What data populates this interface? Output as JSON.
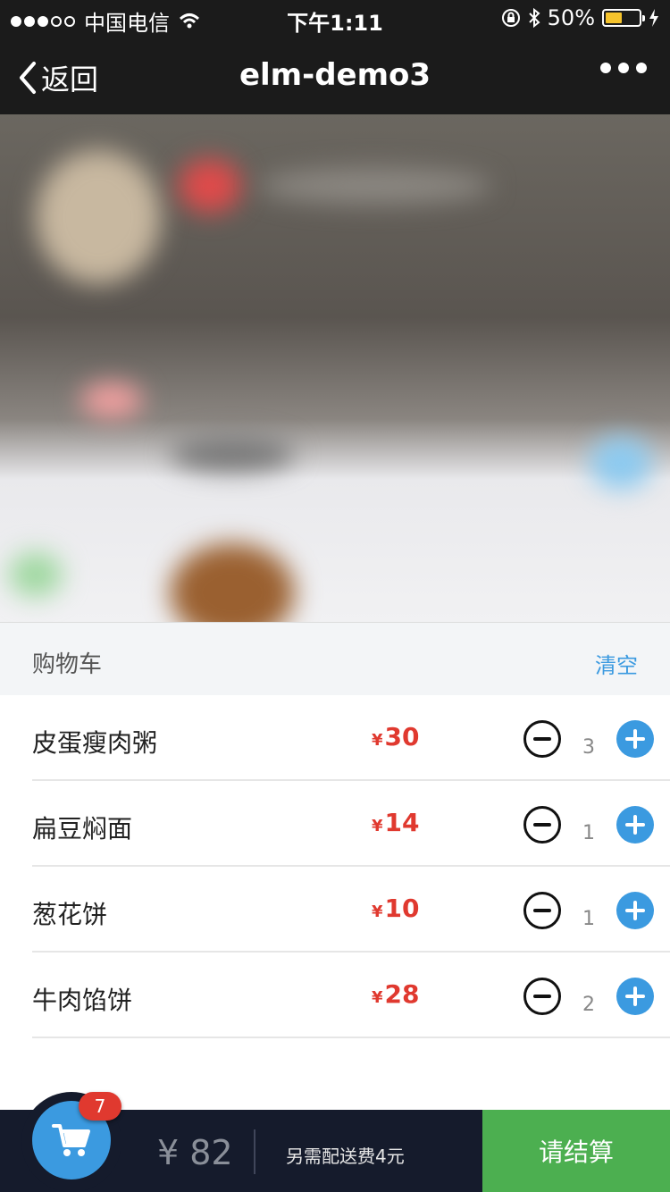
{
  "status_bar": {
    "carrier": "中国电信",
    "time": "下午1:11",
    "battery": "50%"
  },
  "nav": {
    "back_label": "返回",
    "title": "elm-demo3"
  },
  "cart": {
    "title": "购物车",
    "clear_label": "清空",
    "items": [
      {
        "name": "皮蛋瘦肉粥",
        "currency": "¥",
        "price": "30",
        "count": "3"
      },
      {
        "name": "扁豆焖面",
        "currency": "¥",
        "price": "14",
        "count": "1"
      },
      {
        "name": "葱花饼",
        "currency": "¥",
        "price": "10",
        "count": "1"
      },
      {
        "name": "牛肉馅饼",
        "currency": "¥",
        "price": "28",
        "count": "2"
      }
    ]
  },
  "footer": {
    "badge_count": "7",
    "total": "¥ 82",
    "delivery_note": "另需配送费4元",
    "checkout_label": "请结算"
  },
  "colors": {
    "accent_blue": "#3b9ae0",
    "price_red": "#e0392f",
    "checkout_green": "#4caf50",
    "footer_bg": "#151b2c"
  }
}
